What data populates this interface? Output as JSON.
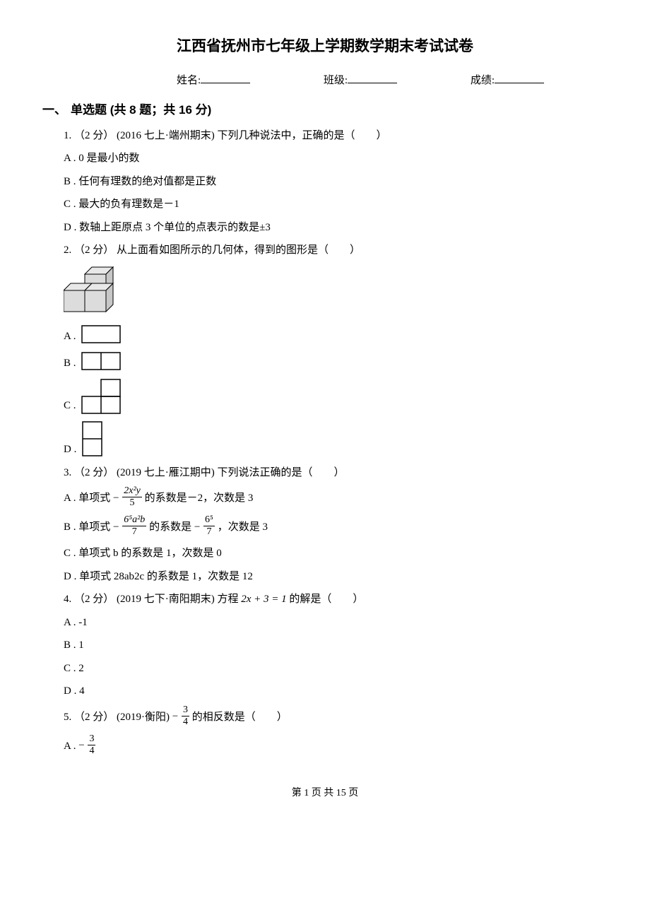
{
  "title": "江西省抚州市七年级上学期数学期末考试试卷",
  "info": {
    "name_label": "姓名:",
    "class_label": "班级:",
    "score_label": "成绩:"
  },
  "section": {
    "num": "一、",
    "title": "单选题 (共 8 题；共 16 分)"
  },
  "q1": {
    "stem": "1. （2 分） (2016 七上·端州期末) 下列几种说法中，正确的是（　　）",
    "a": "A . 0 是最小的数",
    "b": "B . 任何有理数的绝对值都是正数",
    "c": "C . 最大的负有理数是－1",
    "d": "D . 数轴上距原点 3 个单位的点表示的数是±3"
  },
  "q2": {
    "stem": "2. （2 分）  从上面看如图所示的几何体，得到的图形是（　　）",
    "opt_a_label": "A .",
    "opt_b_label": "B .",
    "opt_c_label": "C .",
    "opt_d_label": "D ."
  },
  "q3": {
    "stem": "3. （2 分） (2019 七上·雁江期中) 下列说法正确的是（　　）",
    "a_pre": "A . 单项式 ",
    "a_suf": " 的系数是－2，次数是 3",
    "a_frac_top": "2x²y",
    "a_frac_bot": "5",
    "b_pre": "B . 单项式 ",
    "b_mid": " 的系数是 ",
    "b_suf": " ，次数是 3",
    "b_frac1_top": "6⁵a²b",
    "b_frac1_bot": "7",
    "b_frac2_top": "6⁵",
    "b_frac2_bot": "7",
    "c": "C . 单项式 b 的系数是 1，次数是 0",
    "d": "D . 单项式 28ab2c 的系数是 1，次数是 12"
  },
  "q4": {
    "stem_pre": "4. （2 分） (2019 七下·南阳期末) 方程 ",
    "stem_math": "2x + 3 = 1",
    "stem_suf": " 的解是（　　）",
    "a": "A . -1",
    "b": "B . 1",
    "c": "C . 2",
    "d": "D . 4"
  },
  "q5": {
    "stem_pre": "5. （2 分） (2019·衡阳) ",
    "stem_suf": " 的相反数是（　　）",
    "frac_top": "3",
    "frac_bot": "4",
    "a_label": "A . "
  },
  "footer": "第 1 页 共 15 页"
}
